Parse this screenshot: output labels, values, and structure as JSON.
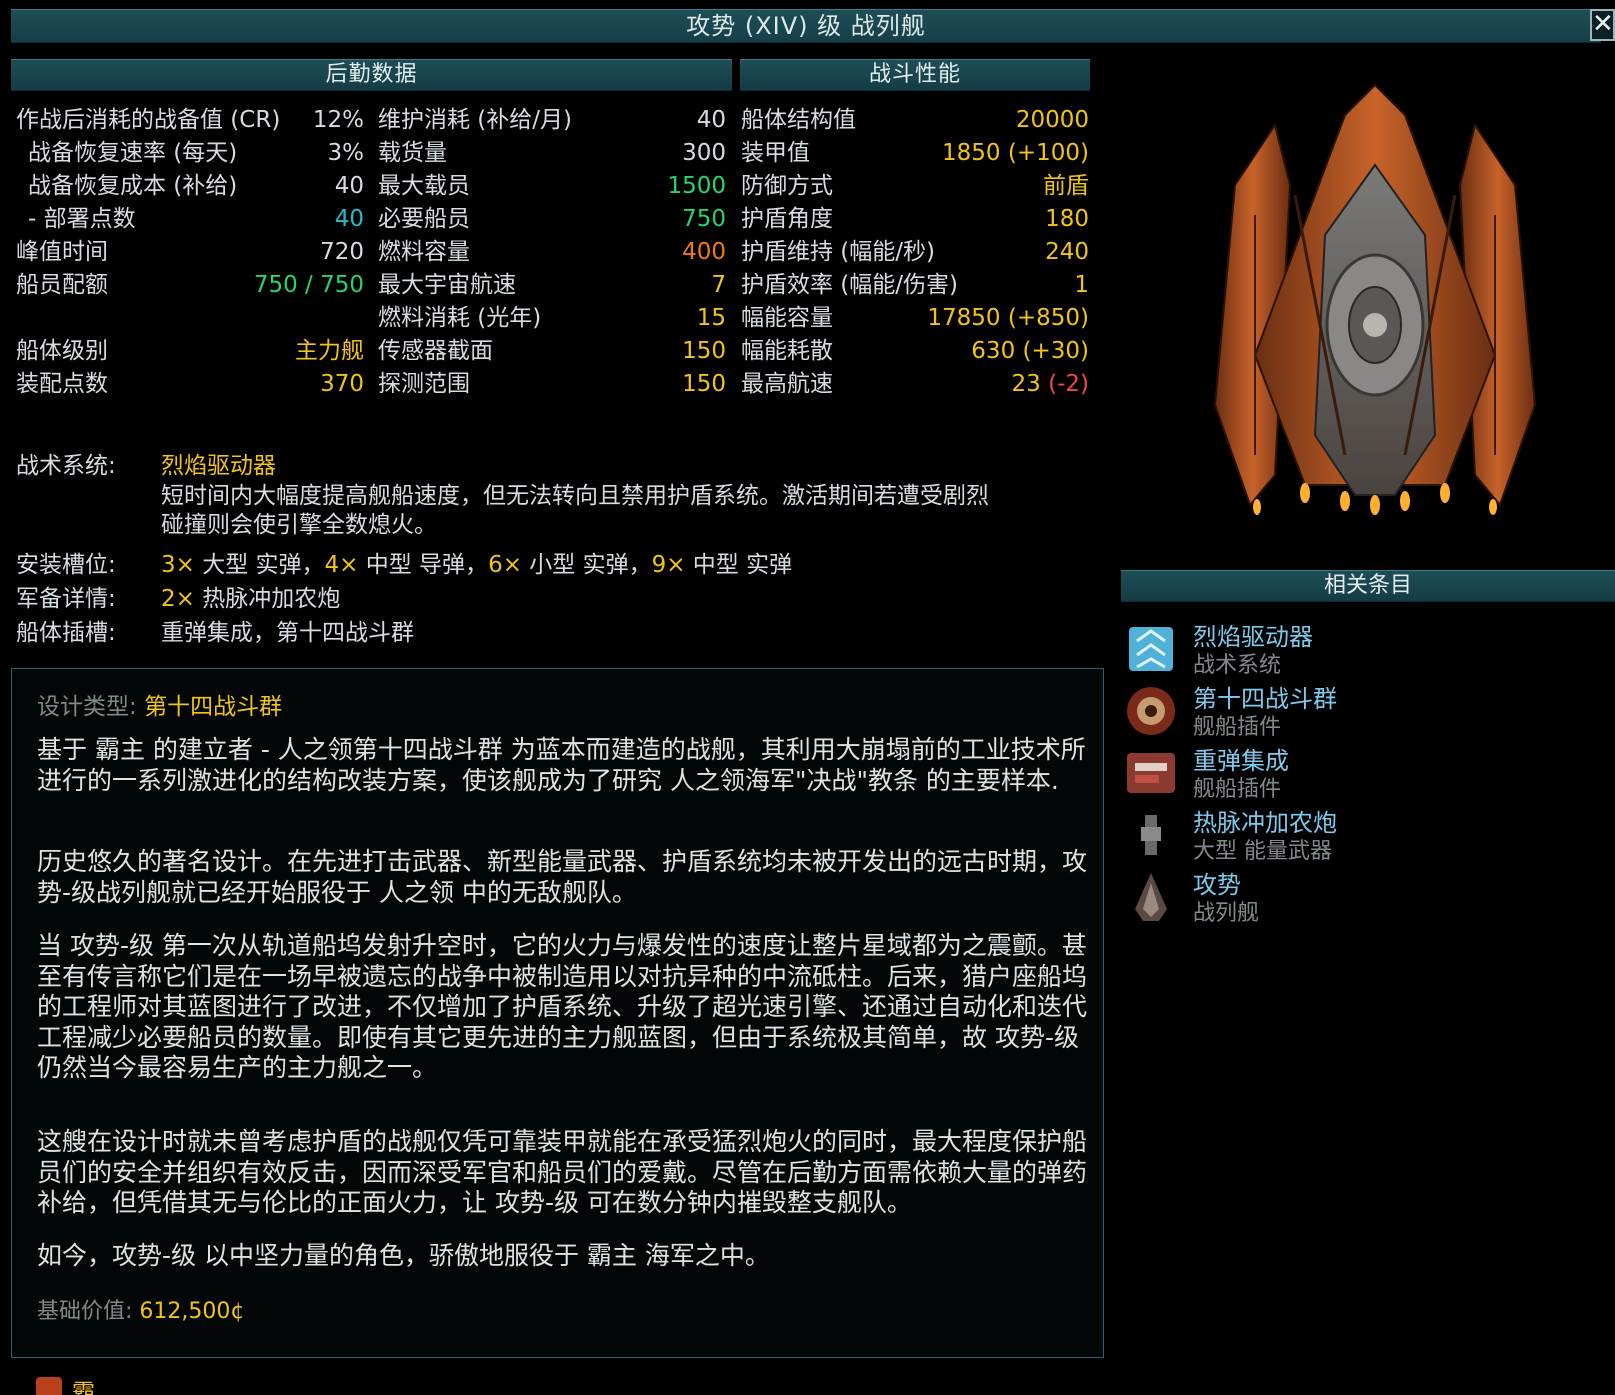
{
  "window": {
    "title": "攻势 (XIV) 级 战列舰",
    "close_glyph": "✕"
  },
  "sections": {
    "logistics": "后勤数据",
    "combat": "战斗性能",
    "related": "相关条目"
  },
  "col1": [
    {
      "label": "作战后消耗的战备值 (CR)",
      "value": "12%",
      "color": "wht",
      "indent": false
    },
    {
      "label": "战备恢复速率 (每天)",
      "value": "3%",
      "color": "wht",
      "indent": true
    },
    {
      "label": "战备恢复成本 (补给)",
      "value": "40",
      "color": "wht",
      "indent": true
    },
    {
      "label": "- 部署点数",
      "value": "40",
      "color": "cyn",
      "indent": true
    },
    {
      "label": "峰值时间",
      "value": "720",
      "color": "wht",
      "indent": false
    },
    {
      "label": "船员配额",
      "value": "750 / 750",
      "color": "grn",
      "indent": false
    },
    {
      "label": "",
      "value": "",
      "color": "wht",
      "indent": false
    },
    {
      "label": "船体级别",
      "value": "主力舰",
      "color": "yel",
      "indent": false
    },
    {
      "label": "装配点数",
      "value": "370",
      "color": "yel",
      "indent": false
    }
  ],
  "col2": [
    {
      "label": "维护消耗 (补给/月)",
      "value": "40",
      "color": "wht"
    },
    {
      "label": "载货量",
      "value": "300",
      "color": "wht"
    },
    {
      "label": "最大载员",
      "value": "1500",
      "color": "grn"
    },
    {
      "label": "必要船员",
      "value": "750",
      "color": "grn"
    },
    {
      "label": "燃料容量",
      "value": "400",
      "color": "org"
    },
    {
      "label": "最大宇宙航速",
      "value": "7",
      "color": "yel"
    },
    {
      "label": "燃料消耗 (光年)",
      "value": "15",
      "color": "yel"
    },
    {
      "label": "传感器截面",
      "value": "150",
      "color": "yel"
    },
    {
      "label": "探测范围",
      "value": "150",
      "color": "yel"
    }
  ],
  "col3": [
    {
      "label": "船体结构值",
      "value": "20000",
      "extra": "",
      "color": "yel"
    },
    {
      "label": "装甲值",
      "value": "1850",
      "extra": " (+100)",
      "color": "yel",
      "extra_color": "yel"
    },
    {
      "label": "防御方式",
      "value": "前盾",
      "extra": "",
      "color": "yel"
    },
    {
      "label": "护盾角度",
      "value": "180",
      "extra": "",
      "color": "yel"
    },
    {
      "label": "护盾维持 (幅能/秒)",
      "value": "240",
      "extra": "",
      "color": "yel"
    },
    {
      "label": "护盾效率 (幅能/伤害)",
      "value": "1",
      "extra": "",
      "color": "yel"
    },
    {
      "label": "幅能容量",
      "value": "17850",
      "extra": " (+850)",
      "color": "yel",
      "extra_color": "yel"
    },
    {
      "label": "幅能耗散",
      "value": "630",
      "extra": " (+30)",
      "color": "yel",
      "extra_color": "yel"
    },
    {
      "label": "最高航速",
      "value": "23",
      "extra": " (-2)",
      "color": "yel",
      "extra_color": "red"
    }
  ],
  "system": {
    "label": "战术系统:",
    "name": "烈焰驱动器",
    "desc1": "短时间内大幅度提高舰船速度，但无法转向且禁用护盾系统。激活期间若遭受剧烈",
    "desc2": "碰撞则会使引擎全数熄火。"
  },
  "mounts": {
    "label": "安装槽位:",
    "parts": [
      {
        "n": "3×",
        "t": " 大型 实弹，"
      },
      {
        "n": "4×",
        "t": " 中型 导弹，"
      },
      {
        "n": "6×",
        "t": " 小型 实弹，"
      },
      {
        "n": "9×",
        "t": " 中型 实弹"
      }
    ]
  },
  "armament": {
    "label": "军备详情:",
    "n": "2×",
    "t": " 热脉冲加农炮"
  },
  "hullmods": {
    "label": "船体插槽:",
    "value": "重弹集成，第十四战斗群"
  },
  "lore": {
    "design_label": "设计类型:",
    "design_value": "第十四战斗群",
    "p1": "基于 霸主 的建立者 - 人之领第十四战斗群 为蓝本而建造的战舰，其利用大崩塌前的工业技术所进行的一系列激进化的结构改装方案，使该舰成为了研究 人之领海军\"决战\"教条 的主要样本.",
    "p2": "历史悠久的著名设计。在先进打击武器、新型能量武器、护盾系统均未被开发出的远古时期，攻势-级战列舰就已经开始服役于 人之领 中的无敌舰队。",
    "p3": "当 攻势-级 第一次从轨道船坞发射升空时，它的火力与爆发性的速度让整片星域都为之震颤。甚至有传言称它们是在一场早被遗忘的战争中被制造用以对抗异种的中流砥柱。后来，猎户座船坞的工程师对其蓝图进行了改进，不仅增加了护盾系统、升级了超光速引擎、还通过自动化和迭代工程减少必要船员的数量。即使有其它更先进的主力舰蓝图，但由于系统极其简单，故 攻势-级 仍然当今最容易生产的主力舰之一。",
    "p4": "这艘在设计时就未曾考虑护盾的战舰仅凭可靠装甲就能在承受猛烈炮火的同时，最大程度保护船员们的安全并组织有效反击，因而深受军官和船员们的爱戴。尽管在后勤方面需依赖大量的弹药补给，但凭借其无与伦比的正面火力，让 攻势-级 可在数分钟内摧毁整支舰队。",
    "p5": "如今，攻势-级 以中坚力量的角色，骄傲地服役于 霸主 海军之中。",
    "price_label": "基础价值:",
    "price_value": "612,500¢"
  },
  "related": [
    {
      "name": "烈焰驱动器",
      "type": "战术系统",
      "icon": "burn-drive-icon"
    },
    {
      "name": "第十四战斗群",
      "type": "舰船插件",
      "icon": "xiv-battlegroup-icon"
    },
    {
      "name": "重弹集成",
      "type": "舰船插件",
      "icon": "ballistic-rangefinder-icon"
    },
    {
      "name": "热脉冲加农炮",
      "type": "大型 能量武器",
      "icon": "heavy-weapon-icon"
    },
    {
      "name": "攻势",
      "type": "战列舰",
      "icon": "onslaught-ship-icon"
    }
  ],
  "faction": {
    "name": "霸主"
  }
}
